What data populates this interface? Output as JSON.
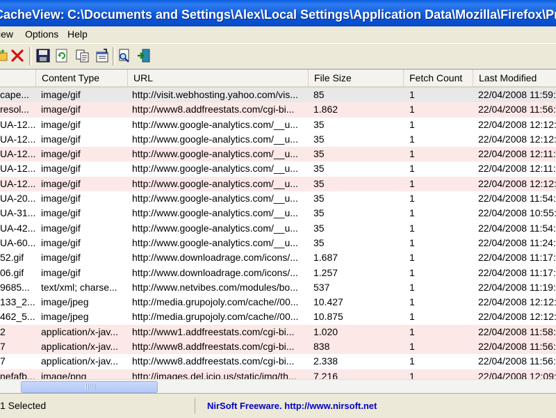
{
  "window": {
    "app_title": "CacheView:",
    "path": "C:\\Documents and Settings\\Alex\\Local Settings\\Application Data\\Mozilla\\Firefox\\Profiles..."
  },
  "menu": {
    "view": "iew",
    "options": "Options",
    "help": "Help"
  },
  "toolbar": {
    "icons": [
      "open-folder-icon",
      "delete-icon",
      "save-icon",
      "refresh-icon",
      "copy-icon",
      "properties-icon",
      "find-icon",
      "exit-icon"
    ]
  },
  "columns": {
    "filename": "",
    "content_type": "Content Type",
    "url": "URL",
    "file_size": "File Size",
    "fetch_count": "Fetch Count",
    "last_modified": "Last Modified"
  },
  "rows": [
    {
      "filename": "cape...",
      "content_type": "image/gif",
      "url": "http://visit.webhosting.yahoo.com/vis...",
      "file_size": "85",
      "fetch_count": "1",
      "last_modified": "22/04/2008 11:59:"
    },
    {
      "filename": "resol...",
      "content_type": "image/gif",
      "url": "http://www8.addfreestats.com/cgi-bi...",
      "file_size": "1.862",
      "fetch_count": "1",
      "last_modified": "22/04/2008 11:56:"
    },
    {
      "filename": "UA-12...",
      "content_type": "image/gif",
      "url": "http://www.google-analytics.com/__u...",
      "file_size": "35",
      "fetch_count": "1",
      "last_modified": "22/04/2008 12:12:"
    },
    {
      "filename": "UA-12...",
      "content_type": "image/gif",
      "url": "http://www.google-analytics.com/__u...",
      "file_size": "35",
      "fetch_count": "1",
      "last_modified": "22/04/2008 12:12:"
    },
    {
      "filename": "UA-12...",
      "content_type": "image/gif",
      "url": "http://www.google-analytics.com/__u...",
      "file_size": "35",
      "fetch_count": "1",
      "last_modified": "22/04/2008 12:11:"
    },
    {
      "filename": "UA-12...",
      "content_type": "image/gif",
      "url": "http://www.google-analytics.com/__u...",
      "file_size": "35",
      "fetch_count": "1",
      "last_modified": "22/04/2008 12:11:"
    },
    {
      "filename": "UA-12...",
      "content_type": "image/gif",
      "url": "http://www.google-analytics.com/__u...",
      "file_size": "35",
      "fetch_count": "1",
      "last_modified": "22/04/2008 12:12:"
    },
    {
      "filename": "UA-20...",
      "content_type": "image/gif",
      "url": "http://www.google-analytics.com/__u...",
      "file_size": "35",
      "fetch_count": "1",
      "last_modified": "22/04/2008 11:54:"
    },
    {
      "filename": "UA-31...",
      "content_type": "image/gif",
      "url": "http://www.google-analytics.com/__u...",
      "file_size": "35",
      "fetch_count": "1",
      "last_modified": "22/04/2008 10:55:"
    },
    {
      "filename": "UA-42...",
      "content_type": "image/gif",
      "url": "http://www.google-analytics.com/__u...",
      "file_size": "35",
      "fetch_count": "1",
      "last_modified": "22/04/2008 11:54:"
    },
    {
      "filename": "UA-60...",
      "content_type": "image/gif",
      "url": "http://www.google-analytics.com/__u...",
      "file_size": "35",
      "fetch_count": "1",
      "last_modified": "22/04/2008 11:24:"
    },
    {
      "filename": "52.gif",
      "content_type": "image/gif",
      "url": "http://www.downloadrage.com/icons/...",
      "file_size": "1.687",
      "fetch_count": "1",
      "last_modified": "22/04/2008 11:17:"
    },
    {
      "filename": "06.gif",
      "content_type": "image/gif",
      "url": "http://www.downloadrage.com/icons/...",
      "file_size": "1.257",
      "fetch_count": "1",
      "last_modified": "22/04/2008 11:17:"
    },
    {
      "filename": "9685...",
      "content_type": "text/xml; charse...",
      "url": "http://www.netvibes.com/modules/bo...",
      "file_size": "537",
      "fetch_count": "1",
      "last_modified": "22/04/2008 11:19:"
    },
    {
      "filename": "133_2...",
      "content_type": "image/jpeg",
      "url": "http://media.grupojoly.com/cache//00...",
      "file_size": "10.427",
      "fetch_count": "1",
      "last_modified": "22/04/2008 12:12:"
    },
    {
      "filename": "462_5...",
      "content_type": "image/jpeg",
      "url": "http://media.grupojoly.com/cache//00...",
      "file_size": "10.875",
      "fetch_count": "1",
      "last_modified": "22/04/2008 12:12:"
    },
    {
      "filename": "2",
      "content_type": "application/x-jav...",
      "url": "http://www1.addfreestats.com/cgi-bi...",
      "file_size": "1.020",
      "fetch_count": "1",
      "last_modified": "22/04/2008 11:58:"
    },
    {
      "filename": "7",
      "content_type": "application/x-jav...",
      "url": "http://www8.addfreestats.com/cgi-bi...",
      "file_size": "838",
      "fetch_count": "1",
      "last_modified": "22/04/2008 11:56:"
    },
    {
      "filename": "7",
      "content_type": "application/x-jav...",
      "url": "http://www8.addfreestats.com/cgi-bi...",
      "file_size": "2.338",
      "fetch_count": "1",
      "last_modified": "22/04/2008 11:56:"
    },
    {
      "filename": "nefafb...",
      "content_type": "image/png",
      "url": "http://images.del.icio.us/static/img/th...",
      "file_size": "7.216",
      "fetch_count": "1",
      "last_modified": "22/04/2008 12:09:"
    }
  ],
  "status": {
    "selected": "1 Selected",
    "credit": "NirSoft Freeware.  http://www.nirsoft.net"
  }
}
